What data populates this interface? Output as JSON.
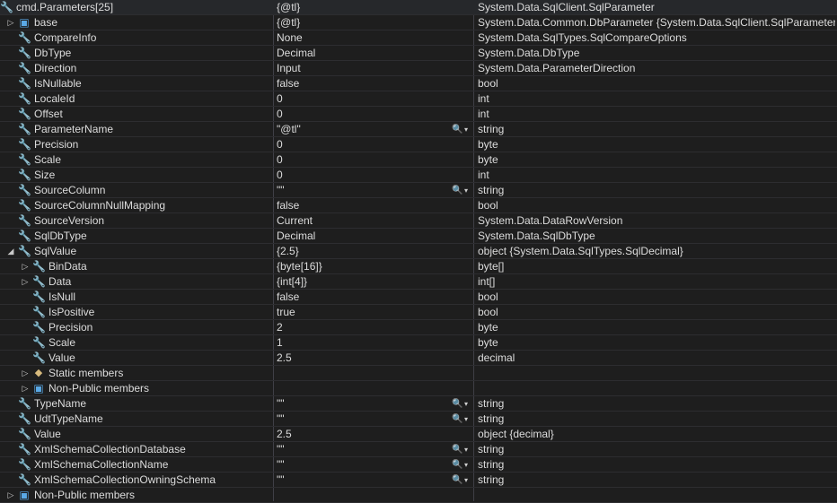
{
  "rows": [
    {
      "name": "cmd.Parameters[25]",
      "value": "{@tl}",
      "type": "System.Data.SqlClient.SqlParameter",
      "icon": "wrench-icon",
      "expander": "expanded",
      "level": 0,
      "visualizer": false
    },
    {
      "name": "base",
      "value": "{@tl}",
      "type": "System.Data.Common.DbParameter {System.Data.SqlClient.SqlParameter}",
      "icon": "cube-icon",
      "expander": "collapsed",
      "level": 1,
      "visualizer": false
    },
    {
      "name": "CompareInfo",
      "value": "None",
      "type": "System.Data.SqlTypes.SqlCompareOptions",
      "icon": "wrench-icon",
      "expander": "",
      "level": 1,
      "visualizer": false
    },
    {
      "name": "DbType",
      "value": "Decimal",
      "type": "System.Data.DbType",
      "icon": "wrench-icon",
      "expander": "",
      "level": 1,
      "visualizer": false
    },
    {
      "name": "Direction",
      "value": "Input",
      "type": "System.Data.ParameterDirection",
      "icon": "wrench-icon",
      "expander": "",
      "level": 1,
      "visualizer": false
    },
    {
      "name": "IsNullable",
      "value": "false",
      "type": "bool",
      "icon": "wrench-icon",
      "expander": "",
      "level": 1,
      "visualizer": false
    },
    {
      "name": "LocaleId",
      "value": "0",
      "type": "int",
      "icon": "wrench-icon",
      "expander": "",
      "level": 1,
      "visualizer": false
    },
    {
      "name": "Offset",
      "value": "0",
      "type": "int",
      "icon": "wrench-icon",
      "expander": "",
      "level": 1,
      "visualizer": false
    },
    {
      "name": "ParameterName",
      "value": "\"@tl\"",
      "type": "string",
      "icon": "wrench-icon",
      "expander": "",
      "level": 1,
      "visualizer": true
    },
    {
      "name": "Precision",
      "value": "0",
      "type": "byte",
      "icon": "wrench-icon",
      "expander": "",
      "level": 1,
      "visualizer": false
    },
    {
      "name": "Scale",
      "value": "0",
      "type": "byte",
      "icon": "wrench-icon",
      "expander": "",
      "level": 1,
      "visualizer": false
    },
    {
      "name": "Size",
      "value": "0",
      "type": "int",
      "icon": "wrench-icon",
      "expander": "",
      "level": 1,
      "visualizer": false
    },
    {
      "name": "SourceColumn",
      "value": "\"\"",
      "type": "string",
      "icon": "wrench-icon",
      "expander": "",
      "level": 1,
      "visualizer": true
    },
    {
      "name": "SourceColumnNullMapping",
      "value": "false",
      "type": "bool",
      "icon": "wrench-icon",
      "expander": "",
      "level": 1,
      "visualizer": false
    },
    {
      "name": "SourceVersion",
      "value": "Current",
      "type": "System.Data.DataRowVersion",
      "icon": "wrench-icon",
      "expander": "",
      "level": 1,
      "visualizer": false
    },
    {
      "name": "SqlDbType",
      "value": "Decimal",
      "type": "System.Data.SqlDbType",
      "icon": "wrench-icon",
      "expander": "",
      "level": 1,
      "visualizer": false
    },
    {
      "name": "SqlValue",
      "value": "{2.5}",
      "type": "object {System.Data.SqlTypes.SqlDecimal}",
      "icon": "wrench-icon",
      "expander": "expanded",
      "level": 1,
      "visualizer": false
    },
    {
      "name": "BinData",
      "value": "{byte[16]}",
      "type": "byte[]",
      "icon": "wrench-icon",
      "expander": "collapsed",
      "level": 2,
      "visualizer": false
    },
    {
      "name": "Data",
      "value": "{int[4]}",
      "type": "int[]",
      "icon": "wrench-icon",
      "expander": "collapsed",
      "level": 2,
      "visualizer": false
    },
    {
      "name": "IsNull",
      "value": "false",
      "type": "bool",
      "icon": "wrench-icon",
      "expander": "",
      "level": 2,
      "visualizer": false
    },
    {
      "name": "IsPositive",
      "value": "true",
      "type": "bool",
      "icon": "wrench-icon",
      "expander": "",
      "level": 2,
      "visualizer": false
    },
    {
      "name": "Precision",
      "value": "2",
      "type": "byte",
      "icon": "wrench-icon",
      "expander": "",
      "level": 2,
      "visualizer": false
    },
    {
      "name": "Scale",
      "value": "1",
      "type": "byte",
      "icon": "wrench-icon",
      "expander": "",
      "level": 2,
      "visualizer": false
    },
    {
      "name": "Value",
      "value": "2.5",
      "type": "decimal",
      "icon": "wrench-icon",
      "expander": "",
      "level": 2,
      "visualizer": false
    },
    {
      "name": "Static members",
      "value": "",
      "type": "",
      "icon": "static-members-icon",
      "expander": "collapsed",
      "level": 2,
      "visualizer": false
    },
    {
      "name": "Non-Public members",
      "value": "",
      "type": "",
      "icon": "cube-icon",
      "expander": "collapsed",
      "level": 2,
      "visualizer": false
    },
    {
      "name": "TypeName",
      "value": "\"\"",
      "type": "string",
      "icon": "wrench-icon",
      "expander": "",
      "level": 1,
      "visualizer": true
    },
    {
      "name": "UdtTypeName",
      "value": "\"\"",
      "type": "string",
      "icon": "wrench-icon",
      "expander": "",
      "level": 1,
      "visualizer": true
    },
    {
      "name": "Value",
      "value": "2.5",
      "type": "object {decimal}",
      "icon": "wrench-icon",
      "expander": "",
      "level": 1,
      "visualizer": false
    },
    {
      "name": "XmlSchemaCollectionDatabase",
      "value": "\"\"",
      "type": "string",
      "icon": "wrench-icon",
      "expander": "",
      "level": 1,
      "visualizer": true
    },
    {
      "name": "XmlSchemaCollectionName",
      "value": "\"\"",
      "type": "string",
      "icon": "wrench-icon",
      "expander": "",
      "level": 1,
      "visualizer": true
    },
    {
      "name": "XmlSchemaCollectionOwningSchema",
      "value": "\"\"",
      "type": "string",
      "icon": "wrench-icon",
      "expander": "",
      "level": 1,
      "visualizer": true
    },
    {
      "name": "Non-Public members",
      "value": "",
      "type": "",
      "icon": "cube-icon",
      "expander": "collapsed",
      "level": 1,
      "visualizer": false
    }
  ],
  "colors": {
    "background": "#1e1e1e",
    "text": "#dcdcdc",
    "divider": "#3f3f46",
    "selected_row": "#26282b",
    "cube": "#5aa9e6"
  }
}
